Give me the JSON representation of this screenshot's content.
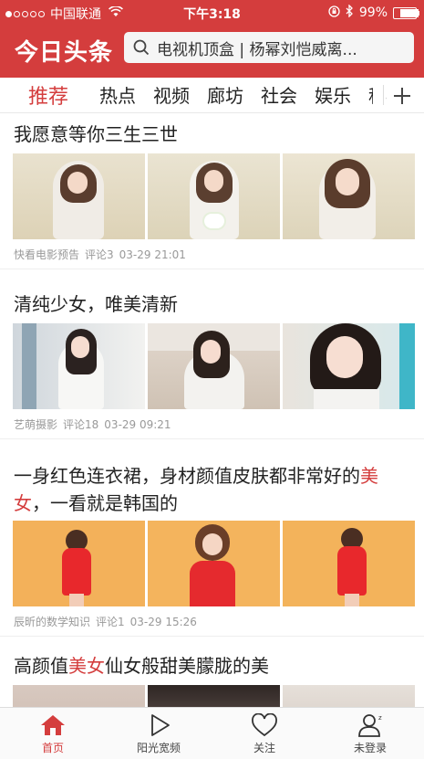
{
  "status_bar": {
    "carrier": "中国联通",
    "time": "下午3:18",
    "battery_text": "99%",
    "battery_level": 0.99
  },
  "header": {
    "logo": "今日头条",
    "search_text": "电视机顶盒 | 杨幂刘恺威离..."
  },
  "tabs": [
    {
      "label": "推荐",
      "active": true
    },
    {
      "label": "热点"
    },
    {
      "label": "视频"
    },
    {
      "label": "廊坊"
    },
    {
      "label": "社会"
    },
    {
      "label": "娱乐"
    },
    {
      "label": "科"
    }
  ],
  "articles": [
    {
      "title": "我愿意等你三生三世",
      "source": "快看电影预告",
      "comments": "评论3",
      "time": "03-29 21:01"
    },
    {
      "title": "清纯少女，唯美清新",
      "source": "艺萌摄影",
      "comments": "评论18",
      "time": "03-29 09:21"
    },
    {
      "title_parts": [
        "一身红色连衣裙，身材颜值皮肤都非常好的",
        "美女",
        "，一看就是韩国的"
      ],
      "source": "辰昕的数学知识",
      "comments": "评论1",
      "time": "03-29 15:26"
    },
    {
      "title_parts": [
        "高颜值",
        "美女",
        "仙女般甜美朦胧的美"
      ]
    }
  ],
  "tabbar": [
    {
      "label": "首页",
      "icon": "home-icon",
      "active": true
    },
    {
      "label": "阳光宽频",
      "icon": "play-icon"
    },
    {
      "label": "关注",
      "icon": "heart-icon"
    },
    {
      "label": "未登录",
      "icon": "user-icon"
    }
  ],
  "colors": {
    "brand_red": "#d43d3d",
    "highlight": "#d43d3d"
  }
}
